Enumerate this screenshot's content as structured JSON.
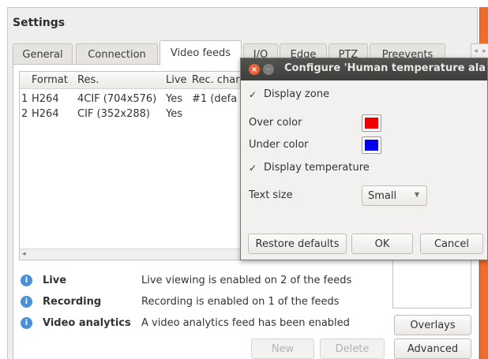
{
  "window": {
    "title": "Settings",
    "tabs": [
      "General",
      "Connection",
      "Video feeds",
      "I/O",
      "Edge",
      "PTZ",
      "Preevents"
    ],
    "active_tab": "Video feeds"
  },
  "feeds_table": {
    "columns": [
      "Format",
      "Res.",
      "Live",
      "Rec. char"
    ],
    "rows": [
      {
        "index": "1",
        "format": "H264",
        "res": "4CIF (704x576)",
        "live": "Yes",
        "rec": "#1 (defa"
      },
      {
        "index": "2",
        "format": "H264",
        "res": "CIF (352x288)",
        "live": "Yes",
        "rec": ""
      }
    ]
  },
  "info": [
    {
      "name": "Live",
      "text": "Live viewing is enabled on 2 of the feeds"
    },
    {
      "name": "Recording",
      "text": "Recording is enabled on 1 of the feeds"
    },
    {
      "name": "Video analytics",
      "text": "A video analytics feed has been enabled"
    }
  ],
  "buttons": {
    "overlays": "Overlays",
    "advanced": "Advanced",
    "new": "New",
    "delete": "Delete"
  },
  "dialog": {
    "title": "Configure 'Human temperature ala",
    "display_zone": "Display zone",
    "display_zone_checked": true,
    "over_color_label": "Over color",
    "over_color": "#ee0000",
    "under_color_label": "Under color",
    "under_color": "#0000ee",
    "display_temperature": "Display temperature",
    "display_temperature_checked": true,
    "text_size_label": "Text size",
    "text_size_value": "Small",
    "restore_defaults": "Restore defaults",
    "ok": "OK",
    "cancel": "Cancel"
  },
  "icons": {
    "check": "✓",
    "info": "i",
    "close": "×"
  }
}
